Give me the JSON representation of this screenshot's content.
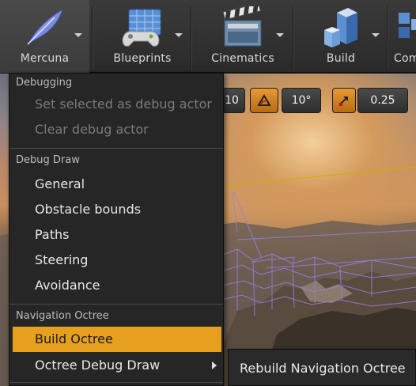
{
  "toolbar": {
    "buttons": [
      {
        "label": "Mercuna",
        "icon": "feather-icon"
      },
      {
        "label": "Blueprints",
        "icon": "blueprint-gamepad-icon"
      },
      {
        "label": "Cinematics",
        "icon": "clapperboard-icon"
      },
      {
        "label": "Build",
        "icon": "build-blocks-icon"
      },
      {
        "label": "Com",
        "icon": "compile-icon"
      }
    ]
  },
  "viewport": {
    "grid_snap": "10",
    "rotation_snap": "10°",
    "scale_snap": "0.25"
  },
  "menu": {
    "sections": [
      {
        "header": "Debugging",
        "items": [
          {
            "label": "Set selected as debug actor",
            "state": "disabled"
          },
          {
            "label": "Clear debug actor",
            "state": "disabled"
          }
        ]
      },
      {
        "header": "Debug Draw",
        "items": [
          {
            "label": "General",
            "state": "enabled"
          },
          {
            "label": "Obstacle bounds",
            "state": "enabled"
          },
          {
            "label": "Paths",
            "state": "enabled"
          },
          {
            "label": "Steering",
            "state": "enabled"
          },
          {
            "label": "Avoidance",
            "state": "enabled"
          }
        ]
      },
      {
        "header": "Navigation Octree",
        "items": [
          {
            "label": "Build Octree",
            "state": "selected"
          },
          {
            "label": "Octree Debug Draw",
            "state": "submenu"
          }
        ]
      }
    ]
  },
  "submenu": {
    "items": [
      {
        "label": "Rebuild Navigation Octree"
      }
    ]
  },
  "colors": {
    "accent": "#e6a01e",
    "menu_bg": "#262626",
    "toolbar_bg": "#333333"
  }
}
